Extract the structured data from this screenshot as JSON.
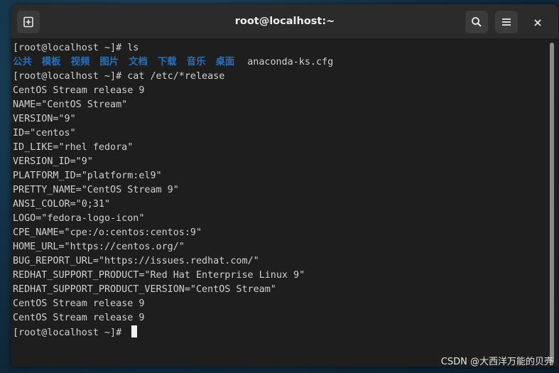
{
  "window": {
    "title": "root@localhost:~"
  },
  "icons": {
    "new_tab": "new-tab-icon",
    "search": "search-icon",
    "menu": "hamburger-menu-icon",
    "close": "close-icon"
  },
  "colors": {
    "directory_blue": "#2a6fb8",
    "terminal_bg": "#1e1e1e",
    "terminal_fg": "#d0d0d0"
  },
  "terminal": {
    "lines": [
      "[root@localhost ~]# ls",
      "",
      "[root@localhost ~]# cat /etc/*release",
      "CentOS Stream release 9",
      "NAME=\"CentOS Stream\"",
      "VERSION=\"9\"",
      "ID=\"centos\"",
      "ID_LIKE=\"rhel fedora\"",
      "VERSION_ID=\"9\"",
      "PLATFORM_ID=\"platform:el9\"",
      "PRETTY_NAME=\"CentOS Stream 9\"",
      "ANSI_COLOR=\"0;31\"",
      "LOGO=\"fedora-logo-icon\"",
      "CPE_NAME=\"cpe:/o:centos:centos:9\"",
      "HOME_URL=\"https://centos.org/\"",
      "BUG_REPORT_URL=\"https://issues.redhat.com/\"",
      "REDHAT_SUPPORT_PRODUCT=\"Red Hat Enterprise Linux 9\"",
      "REDHAT_SUPPORT_PRODUCT_VERSION=\"CentOS Stream\"",
      "CentOS Stream release 9",
      "CentOS Stream release 9",
      "[root@localhost ~]# "
    ],
    "ls_output": {
      "directories": [
        "公共",
        "模板",
        "视频",
        "图片",
        "文档",
        "下载",
        "音乐",
        "桌面"
      ],
      "files": [
        "anaconda-ks.cfg"
      ]
    }
  },
  "watermark": "CSDN @大西洋万能的贝壳"
}
